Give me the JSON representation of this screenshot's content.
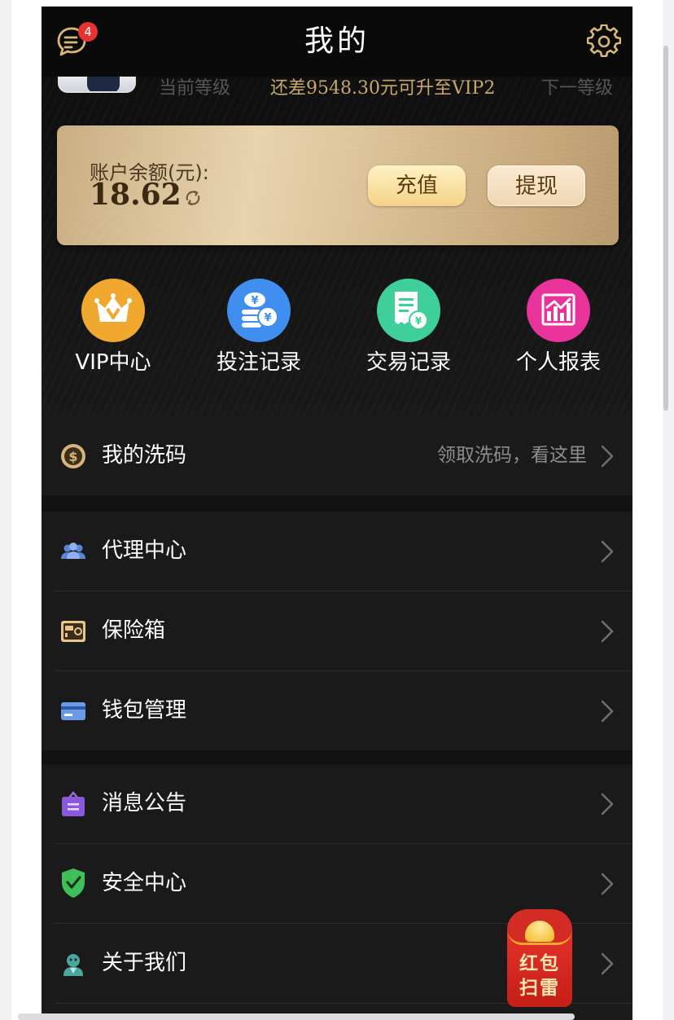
{
  "header": {
    "title": "我的",
    "message_badge": "4"
  },
  "level": {
    "current_label": "当前等级",
    "upgrade_text": "还差9548.30元可升至VIP2",
    "next_label": "下一等级"
  },
  "balance": {
    "label": "账户余额(元):",
    "value": "18.62",
    "recharge_label": "充值",
    "withdraw_label": "提现"
  },
  "quick_actions": [
    {
      "label": "VIP中心",
      "icon": "vip-crown-icon",
      "color": "#f0a92e"
    },
    {
      "label": "投注记录",
      "icon": "coin-stack-icon",
      "color": "#3f8ef0"
    },
    {
      "label": "交易记录",
      "icon": "receipt-icon",
      "color": "#3fcf9a"
    },
    {
      "label": "个人报表",
      "icon": "chart-icon",
      "color": "#e8339a"
    }
  ],
  "menu": {
    "rebate": {
      "label": "我的洗码",
      "hint": "领取洗码，看这里"
    },
    "agent": {
      "label": "代理中心"
    },
    "safe": {
      "label": "保险箱"
    },
    "wallet": {
      "label": "钱包管理"
    },
    "notice": {
      "label": "消息公告"
    },
    "security": {
      "label": "安全中心"
    },
    "about": {
      "label": "关于我们"
    }
  },
  "red_packet": {
    "line1": "红包",
    "line2": "扫雷"
  }
}
